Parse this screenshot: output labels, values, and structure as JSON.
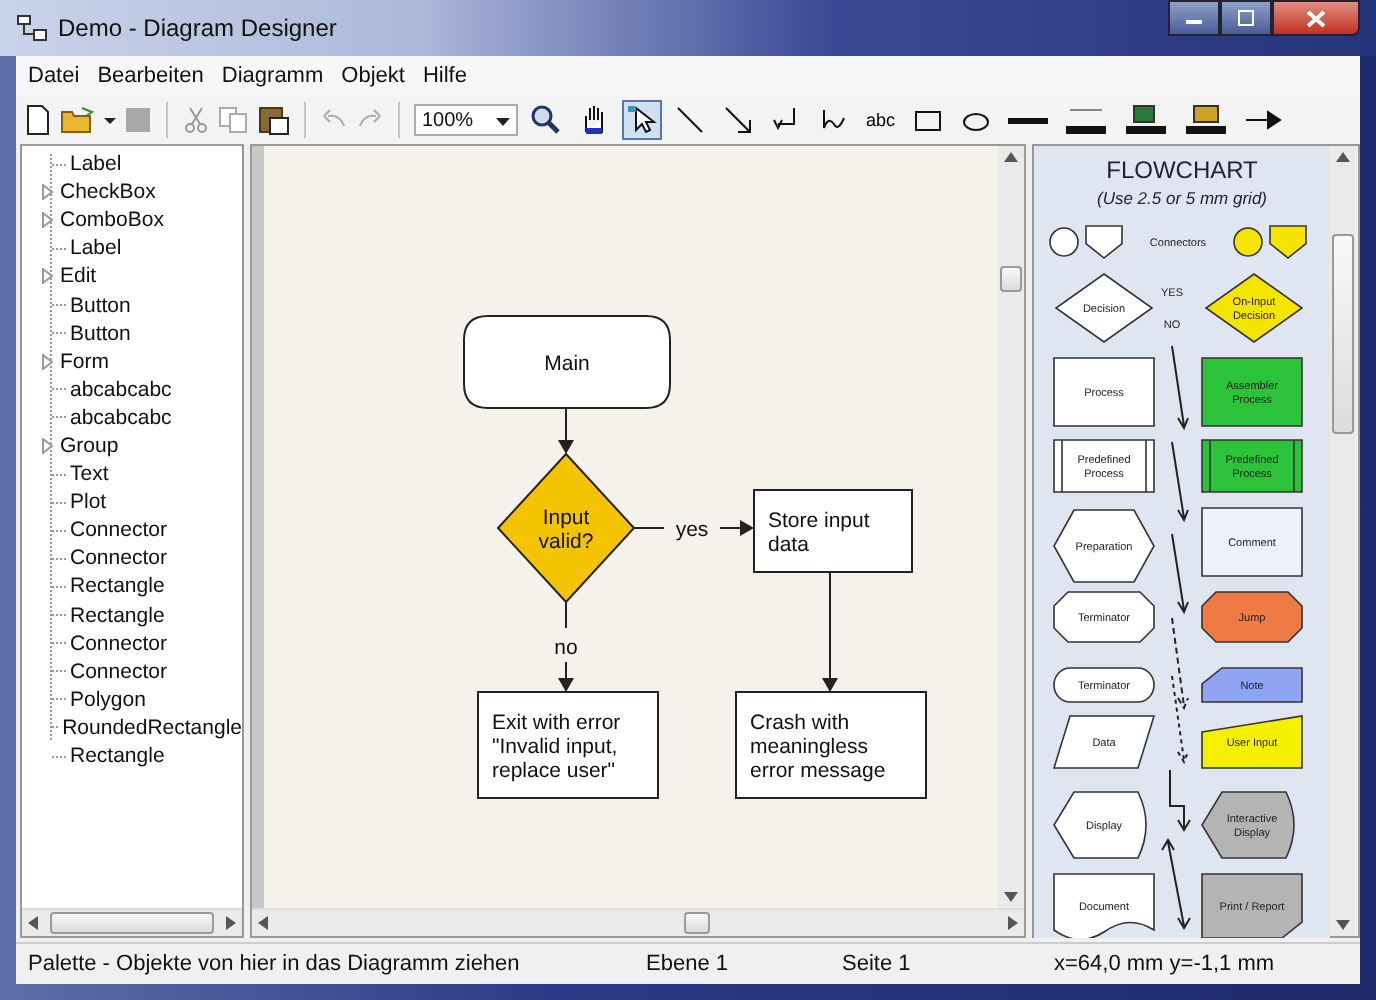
{
  "window": {
    "title": "Demo - Diagram Designer"
  },
  "menu": [
    "Datei",
    "Bearbeiten",
    "Diagramm",
    "Objekt",
    "Hilfe"
  ],
  "toolbar": {
    "zoom": "100%",
    "tools": [
      {
        "kind": "zoom",
        "selected": false
      },
      {
        "kind": "hand",
        "selected": false
      },
      {
        "kind": "pointer",
        "selected": true
      },
      {
        "kind": "line",
        "selected": false
      },
      {
        "kind": "arrow",
        "selected": false
      },
      {
        "kind": "elbow",
        "selected": false
      },
      {
        "kind": "curve",
        "selected": false
      },
      {
        "kind": "text",
        "label": "abc",
        "selected": false
      },
      {
        "kind": "rect",
        "selected": false
      },
      {
        "kind": "ellipse",
        "selected": false
      },
      {
        "kind": "line-width",
        "selected": false
      },
      {
        "kind": "line-color",
        "selected": false
      },
      {
        "kind": "fill-color",
        "selected": false
      },
      {
        "kind": "font-color",
        "selected": false
      },
      {
        "kind": "arrowhead",
        "selected": false
      }
    ]
  },
  "tree": [
    {
      "label": "Label",
      "expandable": false
    },
    {
      "label": "CheckBox",
      "expandable": true
    },
    {
      "label": "ComboBox",
      "expandable": true
    },
    {
      "label": "Label",
      "expandable": false
    },
    {
      "label": "Edit",
      "expandable": true
    },
    {
      "label": "Button",
      "expandable": false
    },
    {
      "label": "Button",
      "expandable": false
    },
    {
      "label": "Form",
      "expandable": true
    },
    {
      "label": "abcabcabc",
      "expandable": false
    },
    {
      "label": "abcabcabc",
      "expandable": false
    },
    {
      "label": "Group",
      "expandable": true
    },
    {
      "label": "Text",
      "expandable": false
    },
    {
      "label": "Plot",
      "expandable": false
    },
    {
      "label": "Connector",
      "expandable": false
    },
    {
      "label": "Connector",
      "expandable": false
    },
    {
      "label": "Rectangle",
      "expandable": false
    },
    {
      "label": "Rectangle",
      "expandable": false
    },
    {
      "label": "Connector",
      "expandable": false
    },
    {
      "label": "Connector",
      "expandable": false
    },
    {
      "label": "Polygon",
      "expandable": false
    },
    {
      "label": "RoundedRectangle",
      "expandable": false
    },
    {
      "label": "Rectangle",
      "expandable": false
    }
  ],
  "diagram": {
    "nodes": [
      {
        "kind": "terminator",
        "lines": [
          "Main"
        ]
      },
      {
        "kind": "decision",
        "lines": [
          "Input",
          "valid?"
        ]
      },
      {
        "kind": "process",
        "lines": [
          "Store input",
          "data"
        ]
      },
      {
        "kind": "process",
        "lines": [
          "Exit with error",
          "\"Invalid input,",
          "replace user\""
        ]
      },
      {
        "kind": "process",
        "lines": [
          "Crash with",
          "meaningless",
          "error message"
        ]
      }
    ],
    "edge_labels": [
      "yes",
      "no"
    ]
  },
  "palette": {
    "title": "FLOWCHART",
    "subtitle": "(Use 2.5 or 5 mm grid)",
    "items": [
      {
        "kind": "circle",
        "color": "#ffffff"
      },
      {
        "kind": "offpage",
        "color": "#ffffff"
      },
      {
        "kind": "caption",
        "lines": [
          "Connectors"
        ]
      },
      {
        "kind": "circle",
        "color": "#f5e400"
      },
      {
        "kind": "offpage",
        "color": "#f5e400"
      },
      {
        "kind": "decision",
        "lines": [
          "Decision"
        ],
        "color": "#ffffff"
      },
      {
        "kind": "caption",
        "lines": [
          "YES"
        ]
      },
      {
        "kind": "caption",
        "lines": [
          "NO"
        ]
      },
      {
        "kind": "decision",
        "lines": [
          "On-Input",
          "Decision"
        ],
        "color": "#f5e400"
      },
      {
        "kind": "process",
        "lines": [
          "Process"
        ],
        "color": "#ffffff"
      },
      {
        "kind": "process",
        "lines": [
          "Assembler",
          "Process"
        ],
        "color": "#2cc23a"
      },
      {
        "kind": "predefined",
        "lines": [
          "Predefined",
          "Process"
        ],
        "color": "#ffffff"
      },
      {
        "kind": "predefined",
        "lines": [
          "Predefined",
          "Process"
        ],
        "color": "#2cc23a"
      },
      {
        "kind": "preparation",
        "lines": [
          "Preparation"
        ],
        "color": "#ffffff"
      },
      {
        "kind": "process",
        "lines": [
          "Comment"
        ],
        "color": "#edf1fb"
      },
      {
        "kind": "octagon",
        "lines": [
          "Terminator"
        ],
        "color": "#ffffff"
      },
      {
        "kind": "octagon",
        "lines": [
          "Jump"
        ],
        "color": "#f07a44"
      },
      {
        "kind": "pill",
        "lines": [
          "Terminator"
        ],
        "color": "#ffffff"
      },
      {
        "kind": "note",
        "lines": [
          "Note"
        ],
        "color": "#8fa4f2"
      },
      {
        "kind": "data",
        "lines": [
          "Data"
        ],
        "color": "#ffffff"
      },
      {
        "kind": "manual",
        "lines": [
          "User Input"
        ],
        "color": "#f5f000"
      },
      {
        "kind": "display",
        "lines": [
          "Display"
        ],
        "color": "#ffffff"
      },
      {
        "kind": "display",
        "lines": [
          "Interactive",
          "Display"
        ],
        "color": "#b4b4b4"
      },
      {
        "kind": "document",
        "lines": [
          "Document"
        ],
        "color": "#ffffff"
      },
      {
        "kind": "report",
        "lines": [
          "Print / Report"
        ],
        "color": "#b4b4b4"
      }
    ]
  },
  "status_bar": [
    "Palette - Objekte von hier in das Diagramm ziehen",
    "Ebene 1",
    "Seite 1",
    "x=64,0 mm  y=-1,1 mm"
  ]
}
